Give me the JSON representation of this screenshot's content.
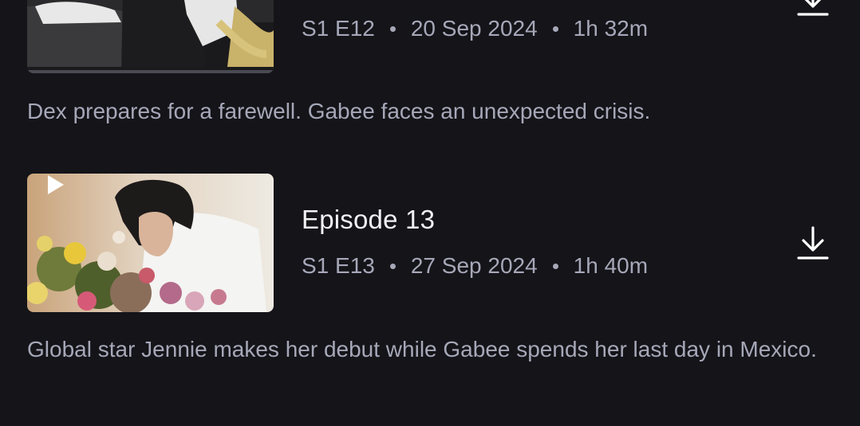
{
  "episodes": [
    {
      "title": "",
      "code": "S1 E12",
      "date": "20 Sep 2024",
      "duration": "1h 32m",
      "description": "Dex prepares for a farewell. Gabee faces an unexpected crisis.",
      "thumbnail_icon": "play-icon",
      "download_icon": "download-icon"
    },
    {
      "title": "Episode 13",
      "code": "S1 E13",
      "date": "27 Sep 2024",
      "duration": "1h 40m",
      "description": "Global star Jennie makes her debut while Gabee spends her last day in Mexico.",
      "thumbnail_icon": "play-icon",
      "download_icon": "download-icon"
    }
  ],
  "colors": {
    "background": "#141419",
    "title": "#f2f2f5",
    "secondary_text": "#a6a8b8"
  }
}
